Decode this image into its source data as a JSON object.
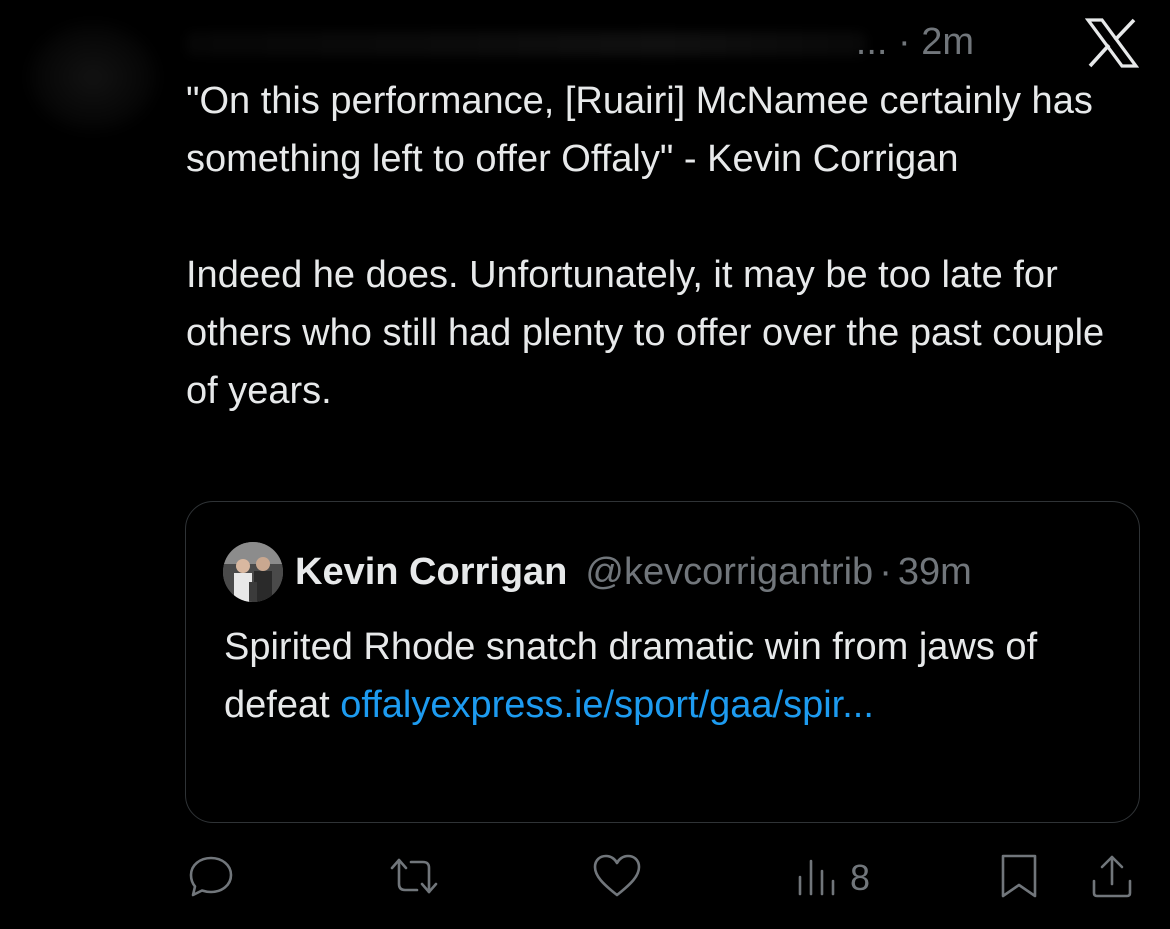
{
  "header": {
    "meta_suffix": "... · 2m",
    "app_logo": "x-logo-icon"
  },
  "tweet": {
    "paragraphs": [
      "\"On this performance, [Ruairi] McNamee certainly has something left to offer Offaly\" - Kevin Corrigan",
      "Indeed he does. Unfortunately, it may be too late for others who still had plenty to offer over the past couple of years."
    ]
  },
  "quote": {
    "name": "Kevin Corrigan",
    "handle": "@kevcorrigantrib",
    "separator": "·",
    "time": "39m",
    "text": "Spirited Rhode snatch dramatic win from jaws of defeat ",
    "link": "offalyexpress.ie/sport/gaa/spir..."
  },
  "actions": {
    "reply_icon": "reply-icon",
    "retweet_icon": "retweet-icon",
    "like_icon": "heart-icon",
    "views_icon": "views-icon",
    "views_count": "8",
    "bookmark_icon": "bookmark-icon",
    "share_icon": "share-icon"
  },
  "colors": {
    "background": "#000000",
    "text": "#e7e9ea",
    "muted": "#71767b",
    "link": "#1d9bf0",
    "border": "#2f3336"
  }
}
